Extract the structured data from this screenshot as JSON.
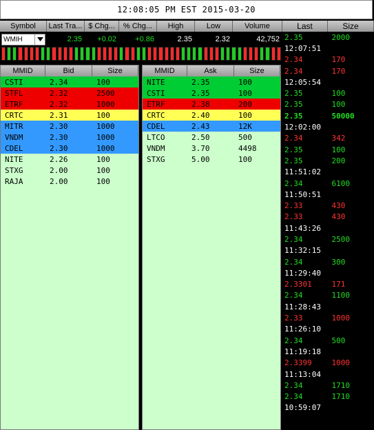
{
  "title": "12:08:05 PM EST 2015-03-20",
  "quote": {
    "headers": [
      "Symbol",
      "Last Tra...",
      "$ Chg...",
      "% Chg...",
      "High",
      "Low",
      "Volume"
    ],
    "symbol": "WMIH",
    "last": "2.35",
    "chg": "+0.02",
    "pct": "+0.86",
    "high": "2.35",
    "low": "2.32",
    "volume": "42,752"
  },
  "tick_colors": [
    "#ff2a2a",
    "#22cc22",
    "#22cc22",
    "#ff2a2a",
    "#ff2a2a",
    "#ff2a2a",
    "#ff2a2a",
    "#22cc22",
    "#22cc22",
    "#ff2a2a",
    "#ff2a2a",
    "#ff2a2a",
    "#ff2a2a",
    "#22cc22",
    "#22cc22",
    "#22cc22",
    "#22cc22",
    "#ff2a2a",
    "#ff2a2a",
    "#ff2a2a",
    "#ff2a2a",
    "#22cc22",
    "#ff2a2a",
    "#ff2a2a",
    "#22cc22",
    "#22cc22",
    "#ff2a2a",
    "#ff2a2a",
    "#ff2a2a",
    "#ff2a2a",
    "#ff2a2a",
    "#ff2a2a",
    "#22cc22",
    "#22cc22",
    "#22cc22",
    "#22cc22",
    "#ff2a2a",
    "#ff2a2a",
    "#ff2a2a",
    "#22cc22",
    "#22cc22",
    "#22cc22",
    "#22cc22",
    "#ff2a2a",
    "#ff2a2a",
    "#ff2a2a",
    "#22cc22",
    "#22cc22",
    "#ff2a2a",
    "#ff2a2a"
  ],
  "bid_book": {
    "headers": [
      "MMID",
      "Bid",
      "Size"
    ],
    "rows": [
      {
        "mmid": "CSTI",
        "price": "2.34",
        "size": "100",
        "bg": "#00cc33",
        "fg": "#000000"
      },
      {
        "mmid": "STFL",
        "price": "2.32",
        "size": "2500",
        "bg": "#ee0000",
        "fg": "#000000"
      },
      {
        "mmid": "ETRF",
        "price": "2.32",
        "size": "1000",
        "bg": "#ee0000",
        "fg": "#000000"
      },
      {
        "mmid": "CRTC",
        "price": "2.31",
        "size": "100",
        "bg": "#ffff55",
        "fg": "#000000"
      },
      {
        "mmid": "MITR",
        "price": "2.30",
        "size": "1000",
        "bg": "#3399ff",
        "fg": "#000000"
      },
      {
        "mmid": "VNDM",
        "price": "2.30",
        "size": "1000",
        "bg": "#3399ff",
        "fg": "#000000"
      },
      {
        "mmid": "CDEL",
        "price": "2.30",
        "size": "1000",
        "bg": "#3399ff",
        "fg": "#000000"
      },
      {
        "mmid": "NITE",
        "price": "2.26",
        "size": "100",
        "bg": "",
        "fg": "#000000"
      },
      {
        "mmid": "STXG",
        "price": "2.00",
        "size": "100",
        "bg": "",
        "fg": "#000000"
      },
      {
        "mmid": "RAJA",
        "price": "2.00",
        "size": "100",
        "bg": "",
        "fg": "#000000"
      }
    ]
  },
  "ask_book": {
    "headers": [
      "MMID",
      "Ask",
      "Size"
    ],
    "rows": [
      {
        "mmid": "NITE",
        "price": "2.35",
        "size": "100",
        "bg": "#00cc33",
        "fg": "#000000"
      },
      {
        "mmid": "CSTI",
        "price": "2.35",
        "size": "100",
        "bg": "#00cc33",
        "fg": "#000000"
      },
      {
        "mmid": "ETRF",
        "price": "2.38",
        "size": "200",
        "bg": "#ee0000",
        "fg": "#000000"
      },
      {
        "mmid": "CRTC",
        "price": "2.40",
        "size": "100",
        "bg": "#ffff55",
        "fg": "#000000"
      },
      {
        "mmid": "CDEL",
        "price": "2.43",
        "size": "12K",
        "bg": "#3399ff",
        "fg": "#000000"
      },
      {
        "mmid": "LTCO",
        "price": "2.50",
        "size": "500",
        "bg": "",
        "fg": "#000000"
      },
      {
        "mmid": "VNDM",
        "price": "3.70",
        "size": "4498",
        "bg": "",
        "fg": "#000000"
      },
      {
        "mmid": "STXG",
        "price": "5.00",
        "size": "100",
        "bg": "",
        "fg": "#000000"
      }
    ]
  },
  "time_sales": {
    "headers": [
      "Last",
      "Size"
    ],
    "items": [
      {
        "type": "trade",
        "price": "2.35",
        "size": "2000",
        "color": "#22dd22"
      },
      {
        "type": "time",
        "text": "12:07:51"
      },
      {
        "type": "trade",
        "price": "2.34",
        "size": "170",
        "color": "#ff3333"
      },
      {
        "type": "trade",
        "price": "2.34",
        "size": "170",
        "color": "#ff3333"
      },
      {
        "type": "time",
        "text": "12:05:54"
      },
      {
        "type": "trade",
        "price": "2.35",
        "size": "100",
        "color": "#22dd22"
      },
      {
        "type": "trade",
        "price": "2.35",
        "size": "100",
        "color": "#22dd22"
      },
      {
        "type": "trade",
        "price": "2.35",
        "size": "50000",
        "color": "#22dd22",
        "bold": true
      },
      {
        "type": "time",
        "text": "12:02:00"
      },
      {
        "type": "trade",
        "price": "2.34",
        "size": "342",
        "color": "#ff3333"
      },
      {
        "type": "trade",
        "price": "2.35",
        "size": "100",
        "color": "#22dd22"
      },
      {
        "type": "trade",
        "price": "2.35",
        "size": "200",
        "color": "#22dd22"
      },
      {
        "type": "time",
        "text": "11:51:02"
      },
      {
        "type": "trade",
        "price": "2.34",
        "size": "6100",
        "color": "#22dd22"
      },
      {
        "type": "time",
        "text": "11:50:51"
      },
      {
        "type": "trade",
        "price": "2.33",
        "size": "430",
        "color": "#ff3333"
      },
      {
        "type": "trade",
        "price": "2.33",
        "size": "430",
        "color": "#ff3333"
      },
      {
        "type": "time",
        "text": "11:43:26"
      },
      {
        "type": "trade",
        "price": "2.34",
        "size": "2500",
        "color": "#22dd22"
      },
      {
        "type": "time",
        "text": "11:32:15"
      },
      {
        "type": "trade",
        "price": "2.34",
        "size": "300",
        "color": "#22dd22"
      },
      {
        "type": "time",
        "text": "11:29:40"
      },
      {
        "type": "trade",
        "price": "2.3301",
        "size": "171",
        "color": "#ff3333"
      },
      {
        "type": "trade",
        "price": "2.34",
        "size": "1100",
        "color": "#22dd22"
      },
      {
        "type": "time",
        "text": "11:28:43"
      },
      {
        "type": "trade",
        "price": "2.33",
        "size": "1000",
        "color": "#ff3333"
      },
      {
        "type": "time",
        "text": "11:26:10"
      },
      {
        "type": "trade",
        "price": "2.34",
        "size": "500",
        "color": "#22dd22"
      },
      {
        "type": "time",
        "text": "11:19:18"
      },
      {
        "type": "trade",
        "price": "2.3399",
        "size": "1000",
        "color": "#ff3333"
      },
      {
        "type": "time",
        "text": "11:13:04"
      },
      {
        "type": "trade",
        "price": "2.34",
        "size": "1710",
        "color": "#22dd22"
      },
      {
        "type": "trade",
        "price": "2.34",
        "size": "1710",
        "color": "#22dd22"
      },
      {
        "type": "time",
        "text": "10:59:07"
      }
    ]
  }
}
